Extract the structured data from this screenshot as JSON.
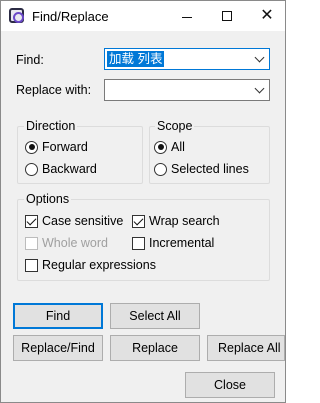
{
  "window": {
    "title": "Find/Replace"
  },
  "find": {
    "label": "Find:",
    "value": "加载 列表"
  },
  "replace": {
    "label": "Replace with:",
    "value": ""
  },
  "direction": {
    "title": "Direction",
    "forward": "Forward",
    "backward": "Backward",
    "selected": "Forward"
  },
  "scope": {
    "title": "Scope",
    "all": "All",
    "selected_lines": "Selected lines",
    "selected": "All"
  },
  "options": {
    "title": "Options",
    "case_sensitive": {
      "label": "Case sensitive",
      "checked": true
    },
    "wrap_search": {
      "label": "Wrap search",
      "checked": true
    },
    "whole_word": {
      "label": "Whole word",
      "checked": false,
      "disabled": true
    },
    "incremental": {
      "label": "Incremental",
      "checked": false
    },
    "regex": {
      "label": "Regular expressions",
      "checked": false
    }
  },
  "buttons": {
    "find": "Find",
    "select_all": "Select All",
    "replace_find": "Replace/Find",
    "replace": "Replace",
    "replace_all": "Replace All",
    "close": "Close"
  },
  "colors": {
    "accent": "#0078d7",
    "dialog_bg": "#f0f0f0",
    "button_bg": "#e1e1e1"
  }
}
